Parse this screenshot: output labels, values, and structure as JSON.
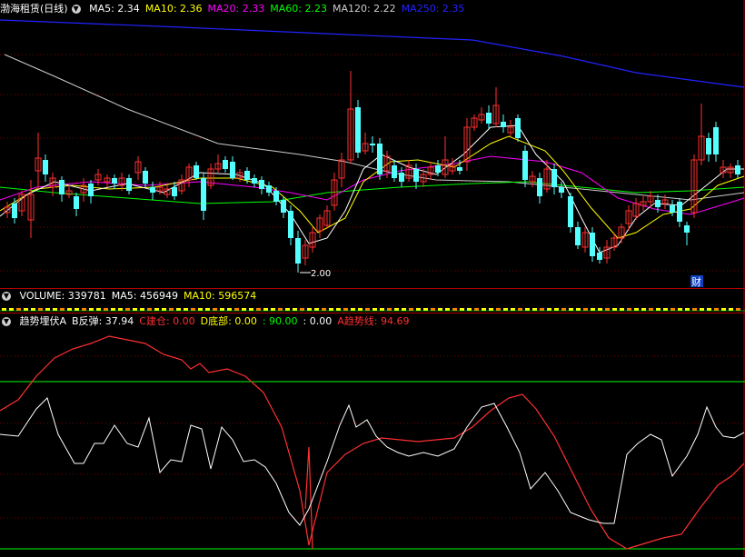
{
  "main": {
    "stock_name": "渤海租赁(日线)",
    "ma_labels": [
      {
        "text": "MA5: 2.34",
        "color": "#ffffff"
      },
      {
        "text": "MA10: 2.36",
        "color": "#ffff00"
      },
      {
        "text": "MA20: 2.33",
        "color": "#ff00ff"
      },
      {
        "text": "MA60: 2.23",
        "color": "#00ff00"
      },
      {
        "text": "MA120: 2.22",
        "color": "#cccccc"
      },
      {
        "text": "MA250: 2.35",
        "color": "#2222ff"
      }
    ],
    "low_marker": "2.00",
    "cai_marker": "财"
  },
  "volume": {
    "labels": [
      {
        "text": "VOLUME: 339781",
        "color": "#ffffff"
      },
      {
        "text": "MA5: 456949",
        "color": "#ffffff"
      },
      {
        "text": "MA10: 596574",
        "color": "#ffff00"
      }
    ]
  },
  "indicator": {
    "labels": [
      {
        "text": "趋势埋伏A",
        "color": "#ffffff"
      },
      {
        "text": "B反弹: 37.94",
        "color": "#ffffff"
      },
      {
        "text": "C建仓: 0.00",
        "color": "#ff3030"
      },
      {
        "text": "D底部: 0.00",
        "color": "#ffff00"
      },
      {
        "text": ": 90.00",
        "color": "#00ff00"
      },
      {
        "text": ": 0.00",
        "color": "#ffffff"
      },
      {
        "text": "A趋势线: 94.69",
        "color": "#ff3030"
      }
    ]
  },
  "colors": {
    "up": "#ff3030",
    "down": "#54ffff",
    "grid": "#7a0000",
    "separator": "#b00000"
  }
}
